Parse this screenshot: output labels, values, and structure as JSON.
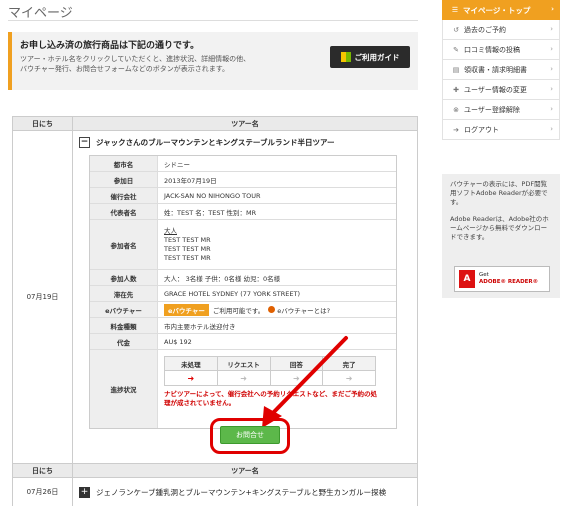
{
  "page": {
    "title": "マイページ"
  },
  "notice": {
    "heading": "お申し込み済の旅行商品は下記の通りです。",
    "text_line1": "ツアー・ホテル名をクリックしていただくと、進捗状況、詳細情報の他、",
    "text_line2": "バウチャー発行、お問合せフォームなどのボタンが表示されます。",
    "guide_button": "ご利用ガイド"
  },
  "table1": {
    "col_date": "日にち",
    "col_tour": "ツアー名",
    "date": "07月19日",
    "tour_name": "ジャックさんのブルーマウンテンとキングステーブルランド半日ツアー",
    "toggle_symbol": "−",
    "details": {
      "city_label": "都市名",
      "city": "シドニー",
      "date_label": "参加日",
      "date": "2013年07月19日",
      "operator_label": "催行会社",
      "operator": "JACK-SAN NO NIHONGO TOUR",
      "rep_label": "代表者名",
      "rep": "姓：TEST 名：TEST 性別：MR",
      "participants_label": "参加者名",
      "participants_head": "大人",
      "participant1": "TEST TEST MR",
      "participant2": "TEST TEST MR",
      "participant3": "TEST TEST MR",
      "count_label": "参加人数",
      "count": "大人： 3名様 子供：0名様 幼児：0名様",
      "stay_label": "滞在先",
      "stay": "GRACE HOTEL SYDNEY (77 YORK STREET)",
      "voucher_label": "eバウチャー",
      "voucher_badge": "eバウチャー",
      "voucher_text": "ご利用可能です。",
      "voucher_link": "eバウチャーとは?",
      "fee_type_label": "料金種類",
      "fee_type": "市内主要ホテル送迎付き",
      "price_label": "代金",
      "price": "AU$ 192",
      "progress_label": "進捗状況"
    },
    "progress": {
      "steps": [
        "未処理",
        "リクエスト",
        "回答",
        "完了"
      ],
      "arrows": [
        "➜",
        "➜",
        "➜",
        "➜"
      ],
      "active_index": 0,
      "note_line1": "ナビツアーによって、催行会社への予約リクエストなど、まだご予約の処",
      "note_line2": "理が成されていません。"
    },
    "contact_button": "お問合せ"
  },
  "table2": {
    "col_date": "日にち",
    "col_tour": "ツアー名",
    "date": "07月26日",
    "toggle_symbol": "+",
    "tour_name": "ジェノランケーブ鍾乳洞とブルーマウンテン+キングステーブルと野生カンガルー探検"
  },
  "sidebar": {
    "items": [
      {
        "label": "マイページ・トップ",
        "icon": "☰",
        "icon_name": "menu-icon"
      },
      {
        "label": "過去のご予約",
        "icon": "↺",
        "icon_name": "history-icon"
      },
      {
        "label": "口コミ情報の投稿",
        "icon": "✎",
        "icon_name": "comment-icon"
      },
      {
        "label": "領収書・請求明細書",
        "icon": "▤",
        "icon_name": "receipt-icon"
      },
      {
        "label": "ユーザー情報の変更",
        "icon": "✚",
        "icon_name": "wrench-icon"
      },
      {
        "label": "ユーザー登録解除",
        "icon": "⊗",
        "icon_name": "unregister-icon"
      },
      {
        "label": "ログアウト",
        "icon": "➔",
        "icon_name": "logout-icon"
      }
    ],
    "chevron": "›"
  },
  "reader": {
    "para1": "バウチャーの表示には、PDF閲覧用ソフトAdobe Readerが必要です。",
    "para2": "Adobe Readerは、Adobe社のホームページから無料でダウンロードできます。",
    "badge_get": "Get",
    "badge_adobe": "ADOBE® READER®",
    "badge_logo": "A"
  },
  "colors": {
    "accent": "#f0a020",
    "alert_red": "#e00000",
    "button_green": "#5cb84a"
  }
}
